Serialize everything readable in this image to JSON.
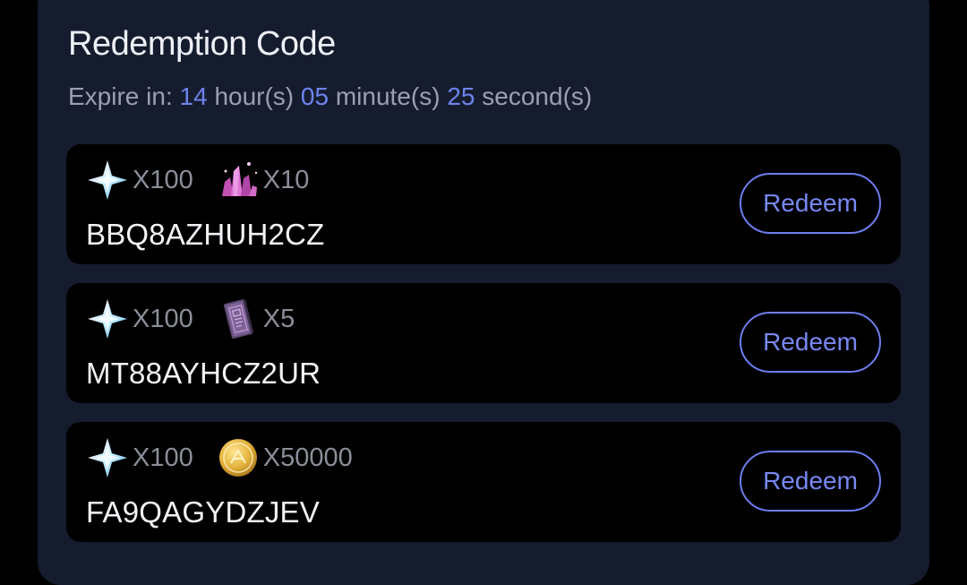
{
  "header": {
    "title": "Redemption Code",
    "expire_prefix": "Expire in:",
    "hours": "14",
    "hours_unit": "hour(s)",
    "minutes": "05",
    "minutes_unit": "minute(s)",
    "seconds": "25",
    "seconds_unit": "second(s)"
  },
  "codes": [
    {
      "code": "BBQ8AZHUH2CZ",
      "rewards": [
        {
          "icon": "primogem-icon",
          "qty": "X100"
        },
        {
          "icon": "crystal-icon",
          "qty": "X10"
        }
      ],
      "button": "Redeem"
    },
    {
      "code": "MT88AYHCZ2UR",
      "rewards": [
        {
          "icon": "primogem-icon",
          "qty": "X100"
        },
        {
          "icon": "book-icon",
          "qty": "X5"
        }
      ],
      "button": "Redeem"
    },
    {
      "code": "FA9QAGYDZJEV",
      "rewards": [
        {
          "icon": "primogem-icon",
          "qty": "X100"
        },
        {
          "icon": "coin-icon",
          "qty": "X50000"
        }
      ],
      "button": "Redeem"
    }
  ],
  "colors": {
    "background": "#000000",
    "panel": "#151c2e",
    "accent": "#6e7ff0",
    "title": "#eef0f6",
    "muted": "#9aa0ae"
  }
}
